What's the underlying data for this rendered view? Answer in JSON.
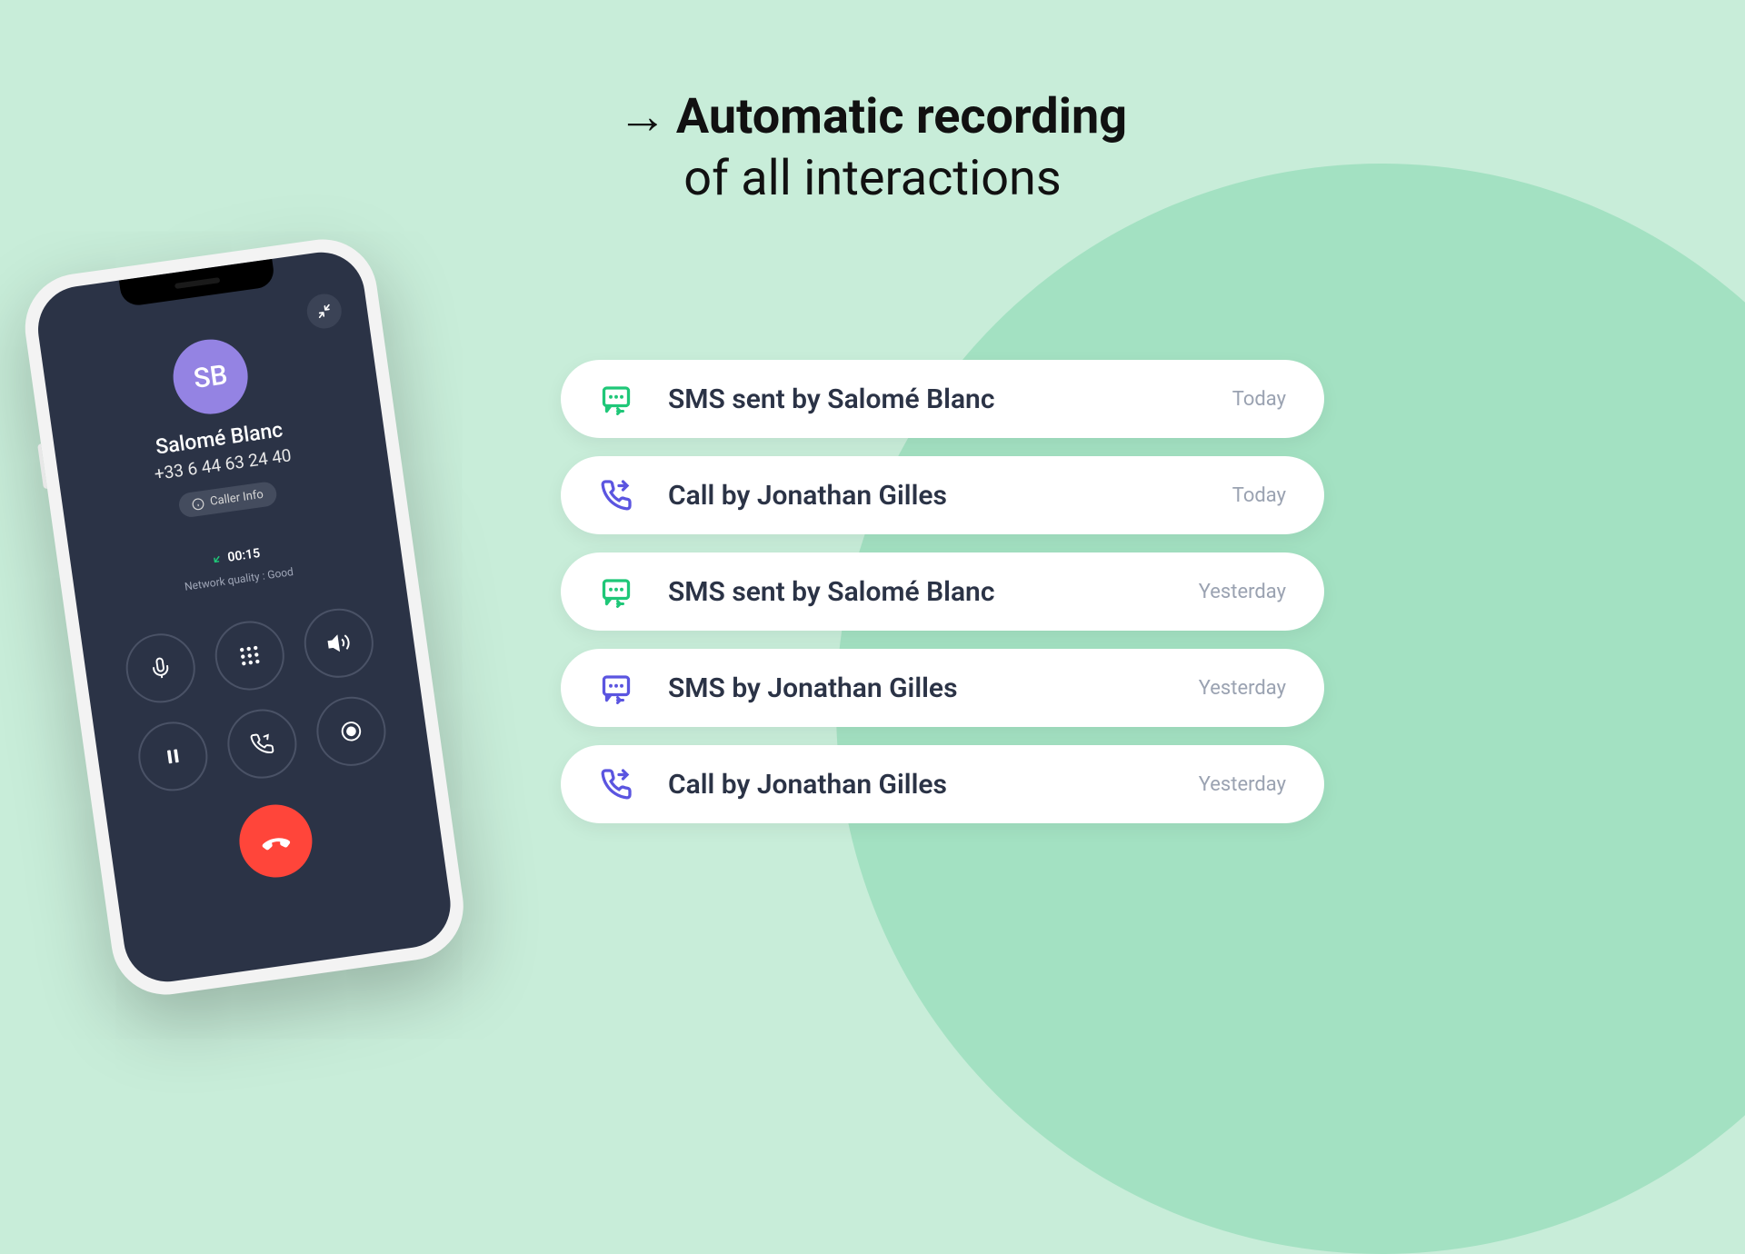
{
  "headline": {
    "arrow": "→",
    "bold": "Automatic recording",
    "rest": "of all interactions"
  },
  "phone": {
    "avatar_initials": "SB",
    "caller_name": "Salomé Blanc",
    "caller_number": "+33 6 44 63 24 40",
    "caller_info_label": "Caller Info",
    "duration": "00:15",
    "network_quality": "Network quality : Good"
  },
  "interactions": [
    {
      "icon": "sms-sent-green",
      "text": "SMS sent by Salomé Blanc",
      "time": "Today"
    },
    {
      "icon": "call-purple",
      "text": "Call by Jonathan Gilles",
      "time": "Today"
    },
    {
      "icon": "sms-sent-green",
      "text": "SMS sent by Salomé Blanc",
      "time": "Yesterday"
    },
    {
      "icon": "sms-purple",
      "text": "SMS by Jonathan Gilles",
      "time": "Yesterday"
    },
    {
      "icon": "call-purple",
      "text": "Call by Jonathan Gilles",
      "time": "Yesterday"
    }
  ],
  "colors": {
    "green": "#1fc778",
    "purple": "#5b55e0"
  }
}
